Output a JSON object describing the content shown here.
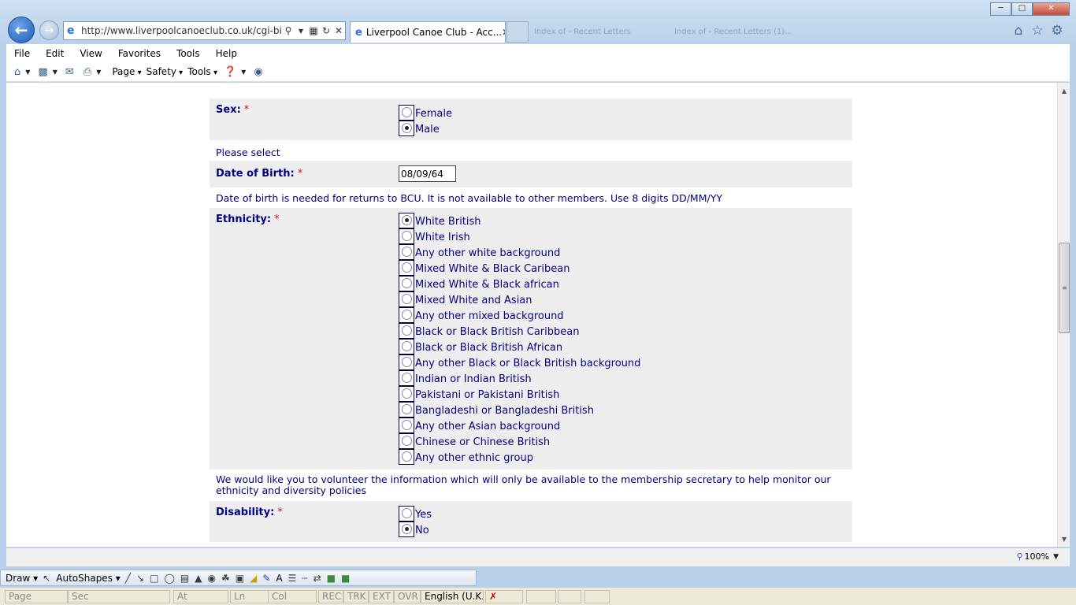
{
  "browser": {
    "address_url": "http://www.liverpoolcanoeclub.co.uk/cgi-bin/",
    "active_tab_title": "Liverpool Canoe Club - Acc...",
    "ghost_tab_1": "Index of - Recent Letters",
    "ghost_tab_2": "Index of - Recent Letters (1)...",
    "menu": [
      "File",
      "Edit",
      "View",
      "Favorites",
      "Tools",
      "Help"
    ],
    "commands": {
      "page": "Page",
      "safety": "Safety",
      "tools": "Tools"
    },
    "zoom": "100%"
  },
  "form": {
    "sex": {
      "label": "Sex:",
      "required_mark": "*",
      "options": [
        {
          "label": "Female",
          "checked": false
        },
        {
          "label": "Male",
          "checked": true
        }
      ],
      "note": "Please select"
    },
    "dob": {
      "label": "Date of Birth:",
      "required_mark": "*",
      "value": "08/09/64",
      "note": "Date of birth is needed for returns to BCU. It is not available to other members. Use 8 digits DD/MM/YY"
    },
    "ethnicity": {
      "label": "Ethnicity:",
      "required_mark": "*",
      "options": [
        {
          "label": "White British",
          "checked": true
        },
        {
          "label": "White Irish",
          "checked": false
        },
        {
          "label": "Any other white background",
          "checked": false
        },
        {
          "label": "Mixed White & Black Caribean",
          "checked": false
        },
        {
          "label": "Mixed White & Black african",
          "checked": false
        },
        {
          "label": "Mixed White and Asian",
          "checked": false
        },
        {
          "label": "Any other mixed background",
          "checked": false
        },
        {
          "label": "Black or Black British Caribbean",
          "checked": false
        },
        {
          "label": "Black or Black British African",
          "checked": false
        },
        {
          "label": "Any other Black or Black British background",
          "checked": false
        },
        {
          "label": "Indian or Indian British",
          "checked": false
        },
        {
          "label": "Pakistani or Pakistani British",
          "checked": false
        },
        {
          "label": "Bangladeshi or Bangladeshi British",
          "checked": false
        },
        {
          "label": "Any other Asian background",
          "checked": false
        },
        {
          "label": "Chinese or Chinese British",
          "checked": false
        },
        {
          "label": "Any other ethnic group",
          "checked": false
        }
      ],
      "note": "We would like you to volunteer the information which will only be available to the membership secretary to help monitor our ethnicity and diversity policies"
    },
    "disability": {
      "label": "Disability:",
      "required_mark": "*",
      "options": [
        {
          "label": "Yes",
          "checked": false
        },
        {
          "label": "No",
          "checked": true
        }
      ]
    }
  },
  "word_toolbar": {
    "draw": "Draw",
    "autoshapes": "AutoShapes"
  },
  "word_status": {
    "page": "Page",
    "sec": "Sec",
    "at": "At",
    "ln": "Ln",
    "col": "Col",
    "rec": "REC",
    "trk": "TRK",
    "ext": "EXT",
    "ovr": "OVR",
    "language": "English (U.K."
  },
  "colors": {
    "form_text": "#000080",
    "required": "#e01010",
    "row_bg": "#eeeeee",
    "chrome": "#b9d1ea"
  }
}
